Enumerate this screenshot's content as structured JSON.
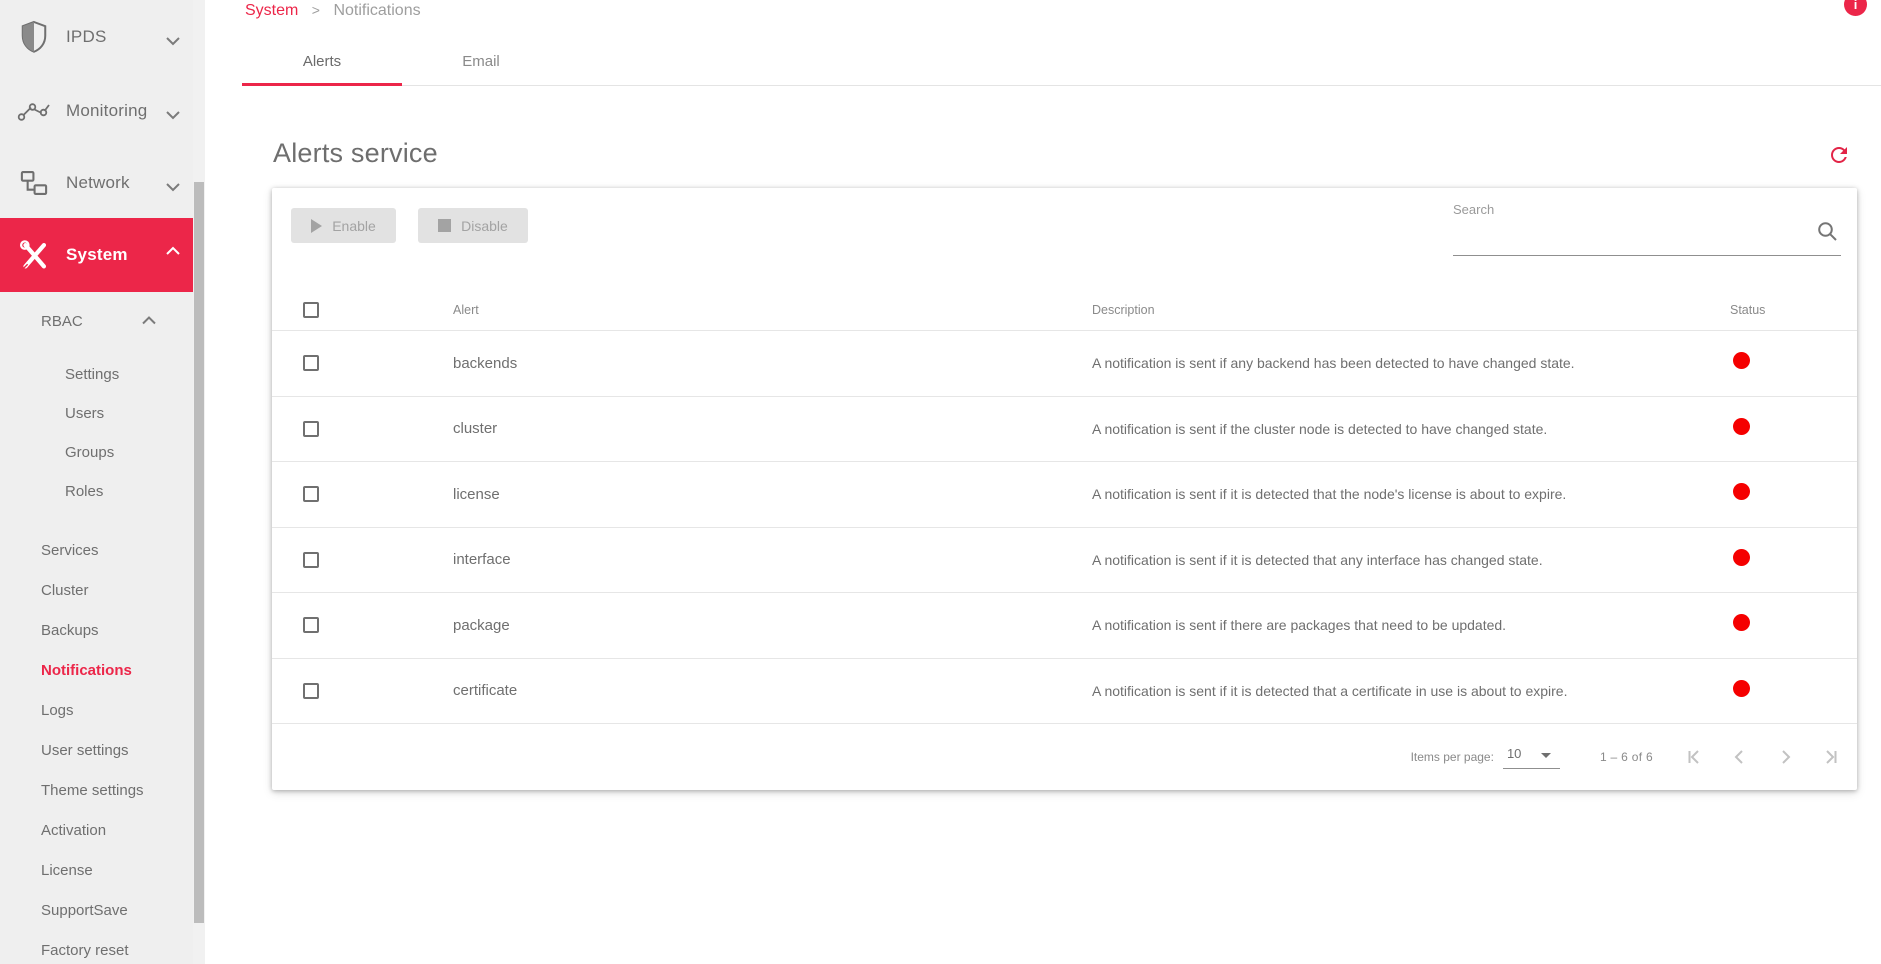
{
  "brand": {
    "accent": "#ec2649",
    "status_red": "#f50000",
    "sidebar_bg": "#efefef"
  },
  "topbar": {
    "breadcrumb": {
      "root": "System",
      "separator": ">",
      "current": "Notifications"
    }
  },
  "tabs": [
    {
      "label": "Alerts",
      "active": true
    },
    {
      "label": "Email",
      "active": false
    }
  ],
  "page": {
    "title": "Alerts service"
  },
  "sidebar": {
    "main_items": [
      {
        "label": "IPDS",
        "icon": "shield-icon",
        "chevron": "down"
      },
      {
        "label": "Monitoring",
        "icon": "activity-icon",
        "chevron": "down"
      },
      {
        "label": "Network",
        "icon": "network-icon",
        "chevron": "down"
      },
      {
        "label": "System",
        "icon": "tools-icon",
        "chevron": "up",
        "active": true
      }
    ],
    "system_submenu": {
      "rbac": {
        "label": "RBAC",
        "expanded": true,
        "children": [
          "Settings",
          "Users",
          "Groups",
          "Roles"
        ]
      },
      "items": [
        "Services",
        "Cluster",
        "Backups",
        "Notifications",
        "Logs",
        "User settings",
        "Theme settings",
        "Activation",
        "License",
        "SupportSave",
        "Factory reset"
      ],
      "active_item": "Notifications"
    }
  },
  "toolbar": {
    "enable_label": "Enable",
    "disable_label": "Disable"
  },
  "search": {
    "label": "Search",
    "value": ""
  },
  "table": {
    "columns": [
      "Alert",
      "Description",
      "Status"
    ],
    "rows": [
      {
        "name": "backends",
        "description": "A notification is sent if any backend has been detected to have changed state.",
        "status": "red"
      },
      {
        "name": "cluster",
        "description": "A notification is sent if the cluster node is detected to have changed state.",
        "status": "red"
      },
      {
        "name": "license",
        "description": "A notification is sent if it is detected that the node's license is about to expire.",
        "status": "red"
      },
      {
        "name": "interface",
        "description": "A notification is sent if it is detected that any interface has changed state.",
        "status": "red"
      },
      {
        "name": "package",
        "description": "A notification is sent if there are packages that need to be updated.",
        "status": "red"
      },
      {
        "name": "certificate",
        "description": "A notification is sent if it is detected that a certificate in use is about to expire.",
        "status": "red"
      }
    ]
  },
  "pagination": {
    "items_per_page_label": "Items per page:",
    "items_per_page": "10",
    "range_label": "1 – 6 of 6"
  }
}
